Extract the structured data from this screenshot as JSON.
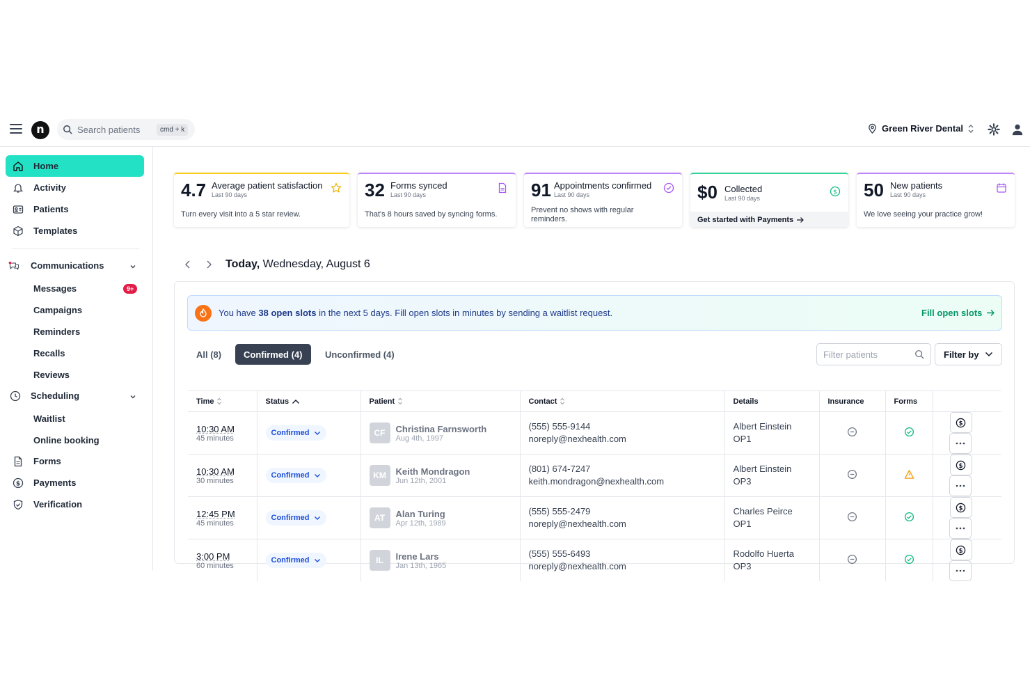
{
  "topbar": {
    "search_placeholder": "Search patients",
    "search_shortcut": "cmd + k",
    "location": "Green River Dental"
  },
  "sidebar": {
    "items": [
      {
        "label": "Home",
        "icon": "home-icon"
      },
      {
        "label": "Activity",
        "icon": "bell-icon"
      },
      {
        "label": "Patients",
        "icon": "id-card-icon"
      },
      {
        "label": "Templates",
        "icon": "cube-icon"
      }
    ],
    "communications": {
      "label": "Communications",
      "sub": [
        "Messages",
        "Campaigns",
        "Reminders",
        "Recalls",
        "Reviews"
      ],
      "messages_badge": "9+"
    },
    "scheduling": {
      "label": "Scheduling",
      "sub": [
        "Waitlist",
        "Online booking"
      ]
    },
    "bottom": [
      {
        "label": "Forms",
        "icon": "document-icon"
      },
      {
        "label": "Payments",
        "icon": "dollar-icon"
      },
      {
        "label": "Verification",
        "icon": "shield-check-icon"
      }
    ]
  },
  "cards": [
    {
      "num": "4.7",
      "title": "Average patient satisfaction",
      "sub": "Last 90 days",
      "desc": "Turn every visit into a 5 star review.",
      "color": "#facc15"
    },
    {
      "num": "32",
      "title": "Forms synced",
      "sub": "Last 90 days",
      "desc": "That's 8 hours saved by syncing forms.",
      "color": "#c084fc"
    },
    {
      "num": "91",
      "title": "Appointments confirmed",
      "sub": "Last 90 days",
      "desc": "Prevent no shows with regular reminders.",
      "color": "#c084fc"
    },
    {
      "num": "$0",
      "title": "Collected",
      "sub": "Last 90 days",
      "foot": "Get started with Payments",
      "color": "#34d399"
    },
    {
      "num": "50",
      "title": "New patients",
      "sub": "Last 90 days",
      "desc": "We love seeing your practice grow!",
      "color": "#c084fc"
    }
  ],
  "date": {
    "today": "Today,",
    "full": "Wednesday, August 6"
  },
  "banner": {
    "pre": "You have",
    "highlight": "38 open slots",
    "post": "in the next 5 days. Fill open slots in minutes by sending a waitlist request.",
    "cta": "Fill open slots"
  },
  "tabs": [
    "All (8)",
    "Confirmed (4)",
    "Unconfirmed (4)"
  ],
  "filter": {
    "placeholder": "Filter patients",
    "filter_by": "Filter by"
  },
  "table": {
    "headers": [
      "Time",
      "Status",
      "Patient",
      "Contact",
      "Details",
      "Insurance",
      "Forms"
    ],
    "rows": [
      {
        "time": "10:30 AM",
        "duration": "45 minutes",
        "status": "Confirmed",
        "initials": "CF",
        "name": "Christina Farnsworth",
        "dob": "Aug 4th, 1997",
        "phone": "(555) 555-9144",
        "email": "noreply@nexhealth.com",
        "provider": "Albert Einstein",
        "op": "OP1",
        "forms": "ok"
      },
      {
        "time": "10:30 AM",
        "duration": "30 minutes",
        "status": "Confirmed",
        "initials": "KM",
        "name": "Keith Mondragon",
        "dob": "Jun 12th, 2001",
        "phone": "(801) 674-7247",
        "email": "keith.mondragon@nexhealth.com",
        "provider": "Albert Einstein",
        "op": "OP3",
        "forms": "warn"
      },
      {
        "time": "12:45 PM",
        "duration": "45 minutes",
        "status": "Confirmed",
        "initials": "AT",
        "name": "Alan Turing",
        "dob": "Apr 12th, 1989",
        "phone": "(555) 555-2479",
        "email": "noreply@nexhealth.com",
        "provider": "Charles Peirce",
        "op": "OP1",
        "forms": "ok"
      },
      {
        "time": "3:00 PM",
        "duration": "60 minutes",
        "status": "Confirmed",
        "initials": "IL",
        "name": "Irene Lars",
        "dob": "Jan 13th, 1965",
        "phone": "(555) 555-6493",
        "email": "noreply@nexhealth.com",
        "provider": "Rodolfo Huerta",
        "op": "OP3",
        "forms": "ok"
      }
    ]
  },
  "colors": {
    "accent": "#22e1c5",
    "ok": "#10b981",
    "warn": "#f59e0b",
    "link": "#059669"
  }
}
